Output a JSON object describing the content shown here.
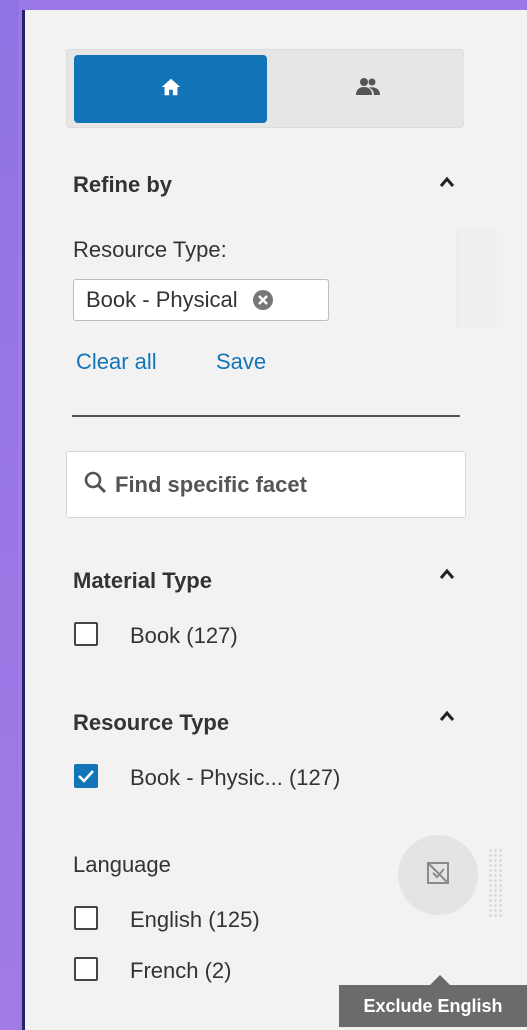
{
  "toggle": {
    "home_icon": "home-icon",
    "users_icon": "users-icon",
    "active": "home"
  },
  "refine": {
    "title": "Refine by",
    "resource_type_label": "Resource Type:",
    "chip": "Book - Physical",
    "clear_all": "Clear all",
    "save": "Save"
  },
  "search": {
    "placeholder": "Find specific facet"
  },
  "facets": {
    "material_type": {
      "title": "Material Type",
      "items": [
        {
          "label": "Book",
          "count": "(127)",
          "checked": false
        }
      ]
    },
    "resource_type": {
      "title": "Resource Type",
      "items": [
        {
          "label": "Book - Physic...",
          "count": "(127)",
          "checked": true
        }
      ]
    },
    "language": {
      "title": "Language",
      "items": [
        {
          "label": "English",
          "count": "(125)",
          "checked": false
        },
        {
          "label": "French",
          "count": "(2)",
          "checked": false
        }
      ]
    }
  },
  "tooltip": "Exclude English",
  "colors": {
    "accent": "#1474b8",
    "panel": "#f2f2f2",
    "background": "#a27be6",
    "tooltip": "#6b6b6b"
  }
}
